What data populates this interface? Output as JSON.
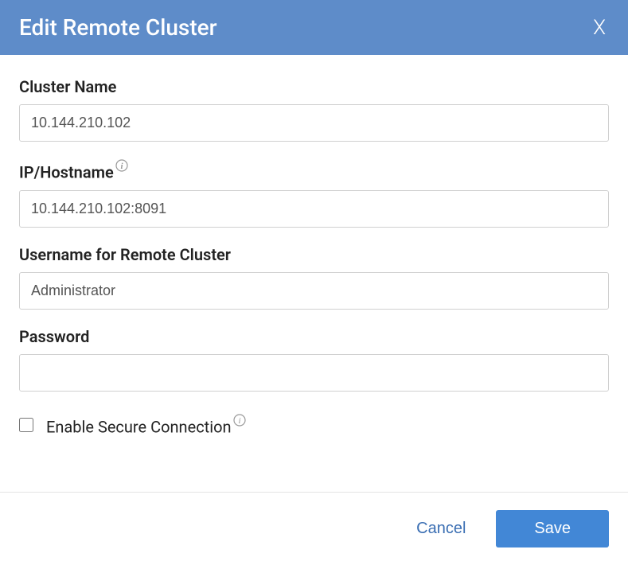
{
  "header": {
    "title": "Edit Remote Cluster",
    "close_label": "X"
  },
  "form": {
    "cluster_name": {
      "label": "Cluster Name",
      "value": "10.144.210.102"
    },
    "ip_hostname": {
      "label": "IP/Hostname",
      "value": "10.144.210.102:8091"
    },
    "username": {
      "label": "Username for Remote Cluster",
      "value": "Administrator"
    },
    "password": {
      "label": "Password",
      "value": ""
    },
    "secure_connection": {
      "label": "Enable Secure Connection",
      "checked": false
    }
  },
  "footer": {
    "cancel_label": "Cancel",
    "save_label": "Save"
  }
}
